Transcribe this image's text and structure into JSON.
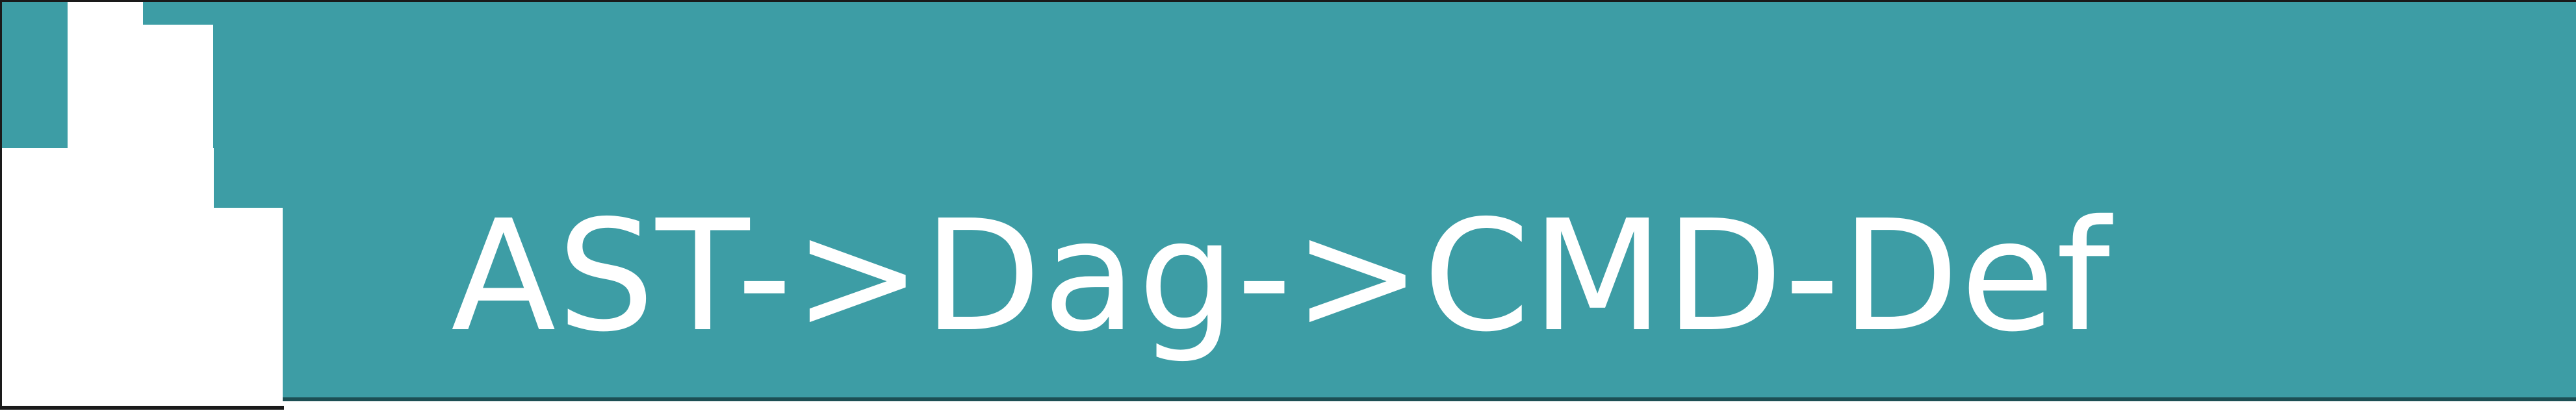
{
  "banner": {
    "title": "AST->Dag->CMD-Def",
    "background_color": "#3d9da5",
    "text_color": "#ffffff"
  }
}
